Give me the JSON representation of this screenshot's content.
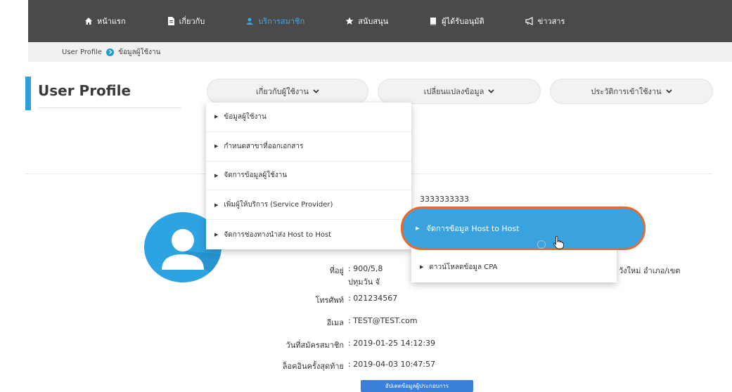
{
  "nav": {
    "items": [
      {
        "label": "หน้าแรก",
        "icon": "home-icon"
      },
      {
        "label": "เกี่ยวกับ",
        "icon": "document-icon"
      },
      {
        "label": "บริการสมาชิก",
        "icon": "users-icon"
      },
      {
        "label": "สนับสนุน",
        "icon": "star-icon"
      },
      {
        "label": "ผู้ได้รับอนุมัติ",
        "icon": "book-icon"
      },
      {
        "label": "ข่าวสาร",
        "icon": "megaphone-icon"
      }
    ],
    "active_color": "#3fa9e6"
  },
  "breadcrumb": {
    "root": "User Profile",
    "current": "ข้อมูลผู้ใช้งาน"
  },
  "page_title": "User Profile",
  "tabs": [
    {
      "label": "เกี่ยวกับผู้ใช้งาน"
    },
    {
      "label": "เปลี่ยนแปลงข้อมูล"
    },
    {
      "label": "ประวัติการเข้าใช้งาน"
    }
  ],
  "dropdown": {
    "items": [
      "ข้อมูลผู้ใช้งาน",
      "กำหนดสาขาที่ออกเอกสาร",
      "จัดการข้อมูลผู้ใช้งาน",
      "เพิ่มผู้ให้บริการ (Service Provider)",
      "จัดการช่องทางนำส่ง Host to Host"
    ]
  },
  "submenu": {
    "items": [
      "จัดการข้อมูล Host to Host",
      "ดาวน์โหลดข้อมูล CPA"
    ],
    "highlight_color": "#3ba2e0",
    "highlight_border": "#e8692c"
  },
  "profile": {
    "id_partial": "3333333333",
    "address_label": "ที่อยู่",
    "address_value": ": 900/5,8",
    "address_line2": "ปทุมวัน จั",
    "address_tail": "วังใหม่ อำเภอ/เขต",
    "phone_label": "โทรศัพท์",
    "phone_value": ": 021234567",
    "email_label": "อีเมล",
    "email_value": ": TEST@TEST.com",
    "joined_label": "วันที่สมัครสมาชิก",
    "joined_value": ": 2019-01-25 14:12:39",
    "last_login_label": "ล็อคอินครั้งสุดท้าย",
    "last_login_value": ": 2019-04-03 10:47:57",
    "update_button": "อัปเดตข้อมูลผู้ประกอบการ"
  }
}
